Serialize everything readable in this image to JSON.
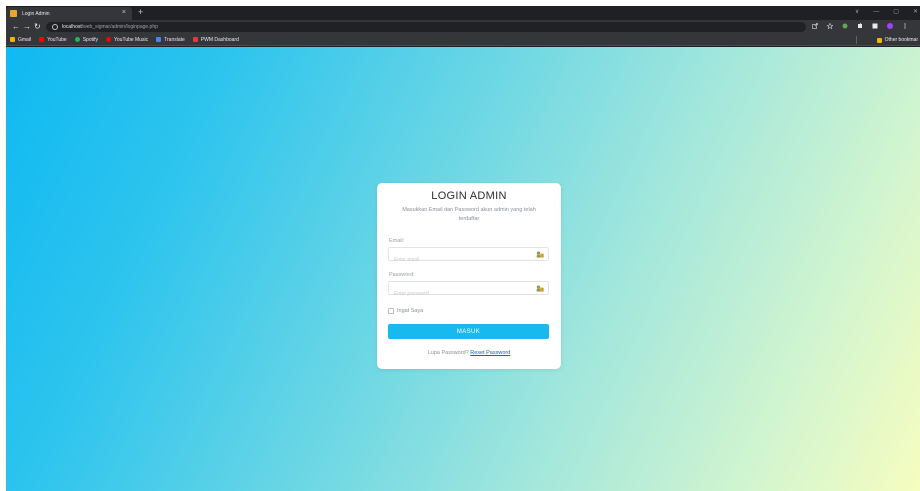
{
  "browser": {
    "tab_title": "Login Admin",
    "tab_close": "×",
    "new_tab": "+",
    "window_controls": [
      "∨",
      "—",
      "▢",
      "✕"
    ],
    "url_host": "localhost",
    "url_path": "/web_sigmar/admin/loginpage.php",
    "bookmarks": [
      {
        "label": "Gmail",
        "icon": "gmail-icon",
        "color": "#f4b400"
      },
      {
        "label": "YouTube",
        "icon": "youtube-icon",
        "color": "#ff0000"
      },
      {
        "label": "Spotify",
        "icon": "spotify-icon",
        "color": "#1db954"
      },
      {
        "label": "YouTube Music",
        "icon": "youtube-music-icon",
        "color": "#ff0000"
      },
      {
        "label": "Translate",
        "icon": "translate-icon",
        "color": "#4285f4"
      },
      {
        "label": "PWM Dashboard",
        "icon": "dashboard-icon",
        "color": "#e53935"
      }
    ],
    "other_bookmarks": "Other bookmar"
  },
  "login": {
    "title": "LOGIN ADMIN",
    "subtitle": "Masukkan Email dan Password akun admin yang telah terdaftar",
    "email_label": "Email:",
    "email_placeholder": "Enter email",
    "password_label": "Password:",
    "password_placeholder": "Enter password",
    "remember_label": "Ingat Saya",
    "submit_label": "MASUK",
    "forgot_text": "Lupa Password?",
    "reset_link": "Reset Password"
  },
  "colors": {
    "accent": "#17b9ee",
    "gradient_start": "#0fb9f2",
    "gradient_end": "#f6fdbf",
    "link": "#1a5fb4"
  }
}
